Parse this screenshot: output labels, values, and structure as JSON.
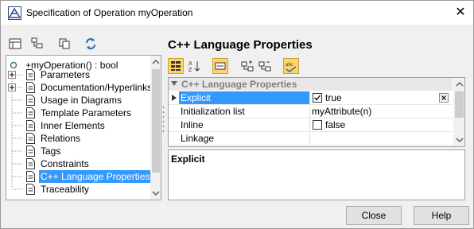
{
  "window": {
    "title": "Specification of Operation myOperation"
  },
  "tree": {
    "root": "+myOperation() : bool",
    "items": [
      {
        "label": "Parameters",
        "expandable": true
      },
      {
        "label": "Documentation/Hyperlinks",
        "expandable": true
      },
      {
        "label": "Usage in Diagrams",
        "expandable": false
      },
      {
        "label": "Template Parameters",
        "expandable": false
      },
      {
        "label": "Inner Elements",
        "expandable": false
      },
      {
        "label": "Relations",
        "expandable": false
      },
      {
        "label": "Tags",
        "expandable": false
      },
      {
        "label": "Constraints",
        "expandable": false
      },
      {
        "label": "C++ Language Properties",
        "expandable": false,
        "selected": true
      },
      {
        "label": "Traceability",
        "expandable": false
      }
    ]
  },
  "main": {
    "heading": "C++ Language Properties",
    "group": "C++ Language Properties",
    "properties": [
      {
        "name": "Explicit",
        "value": "true",
        "checkbox": true,
        "checked": true,
        "selected": true
      },
      {
        "name": "Initialization list",
        "value": "myAttribute(n)",
        "checkbox": false
      },
      {
        "name": "Inline",
        "value": "false",
        "checkbox": true,
        "checked": false
      },
      {
        "name": "Linkage",
        "value": "",
        "checkbox": false
      }
    ],
    "description_title": "Explicit"
  },
  "buttons": {
    "close": "Close",
    "help": "Help"
  },
  "icons": {
    "app": "magicdraw-icon",
    "close": "close-icon",
    "colors": {
      "selection": "#3399ff",
      "accent_icon": "#2b6cb0",
      "toolbar_active": "#ffd36b"
    }
  }
}
